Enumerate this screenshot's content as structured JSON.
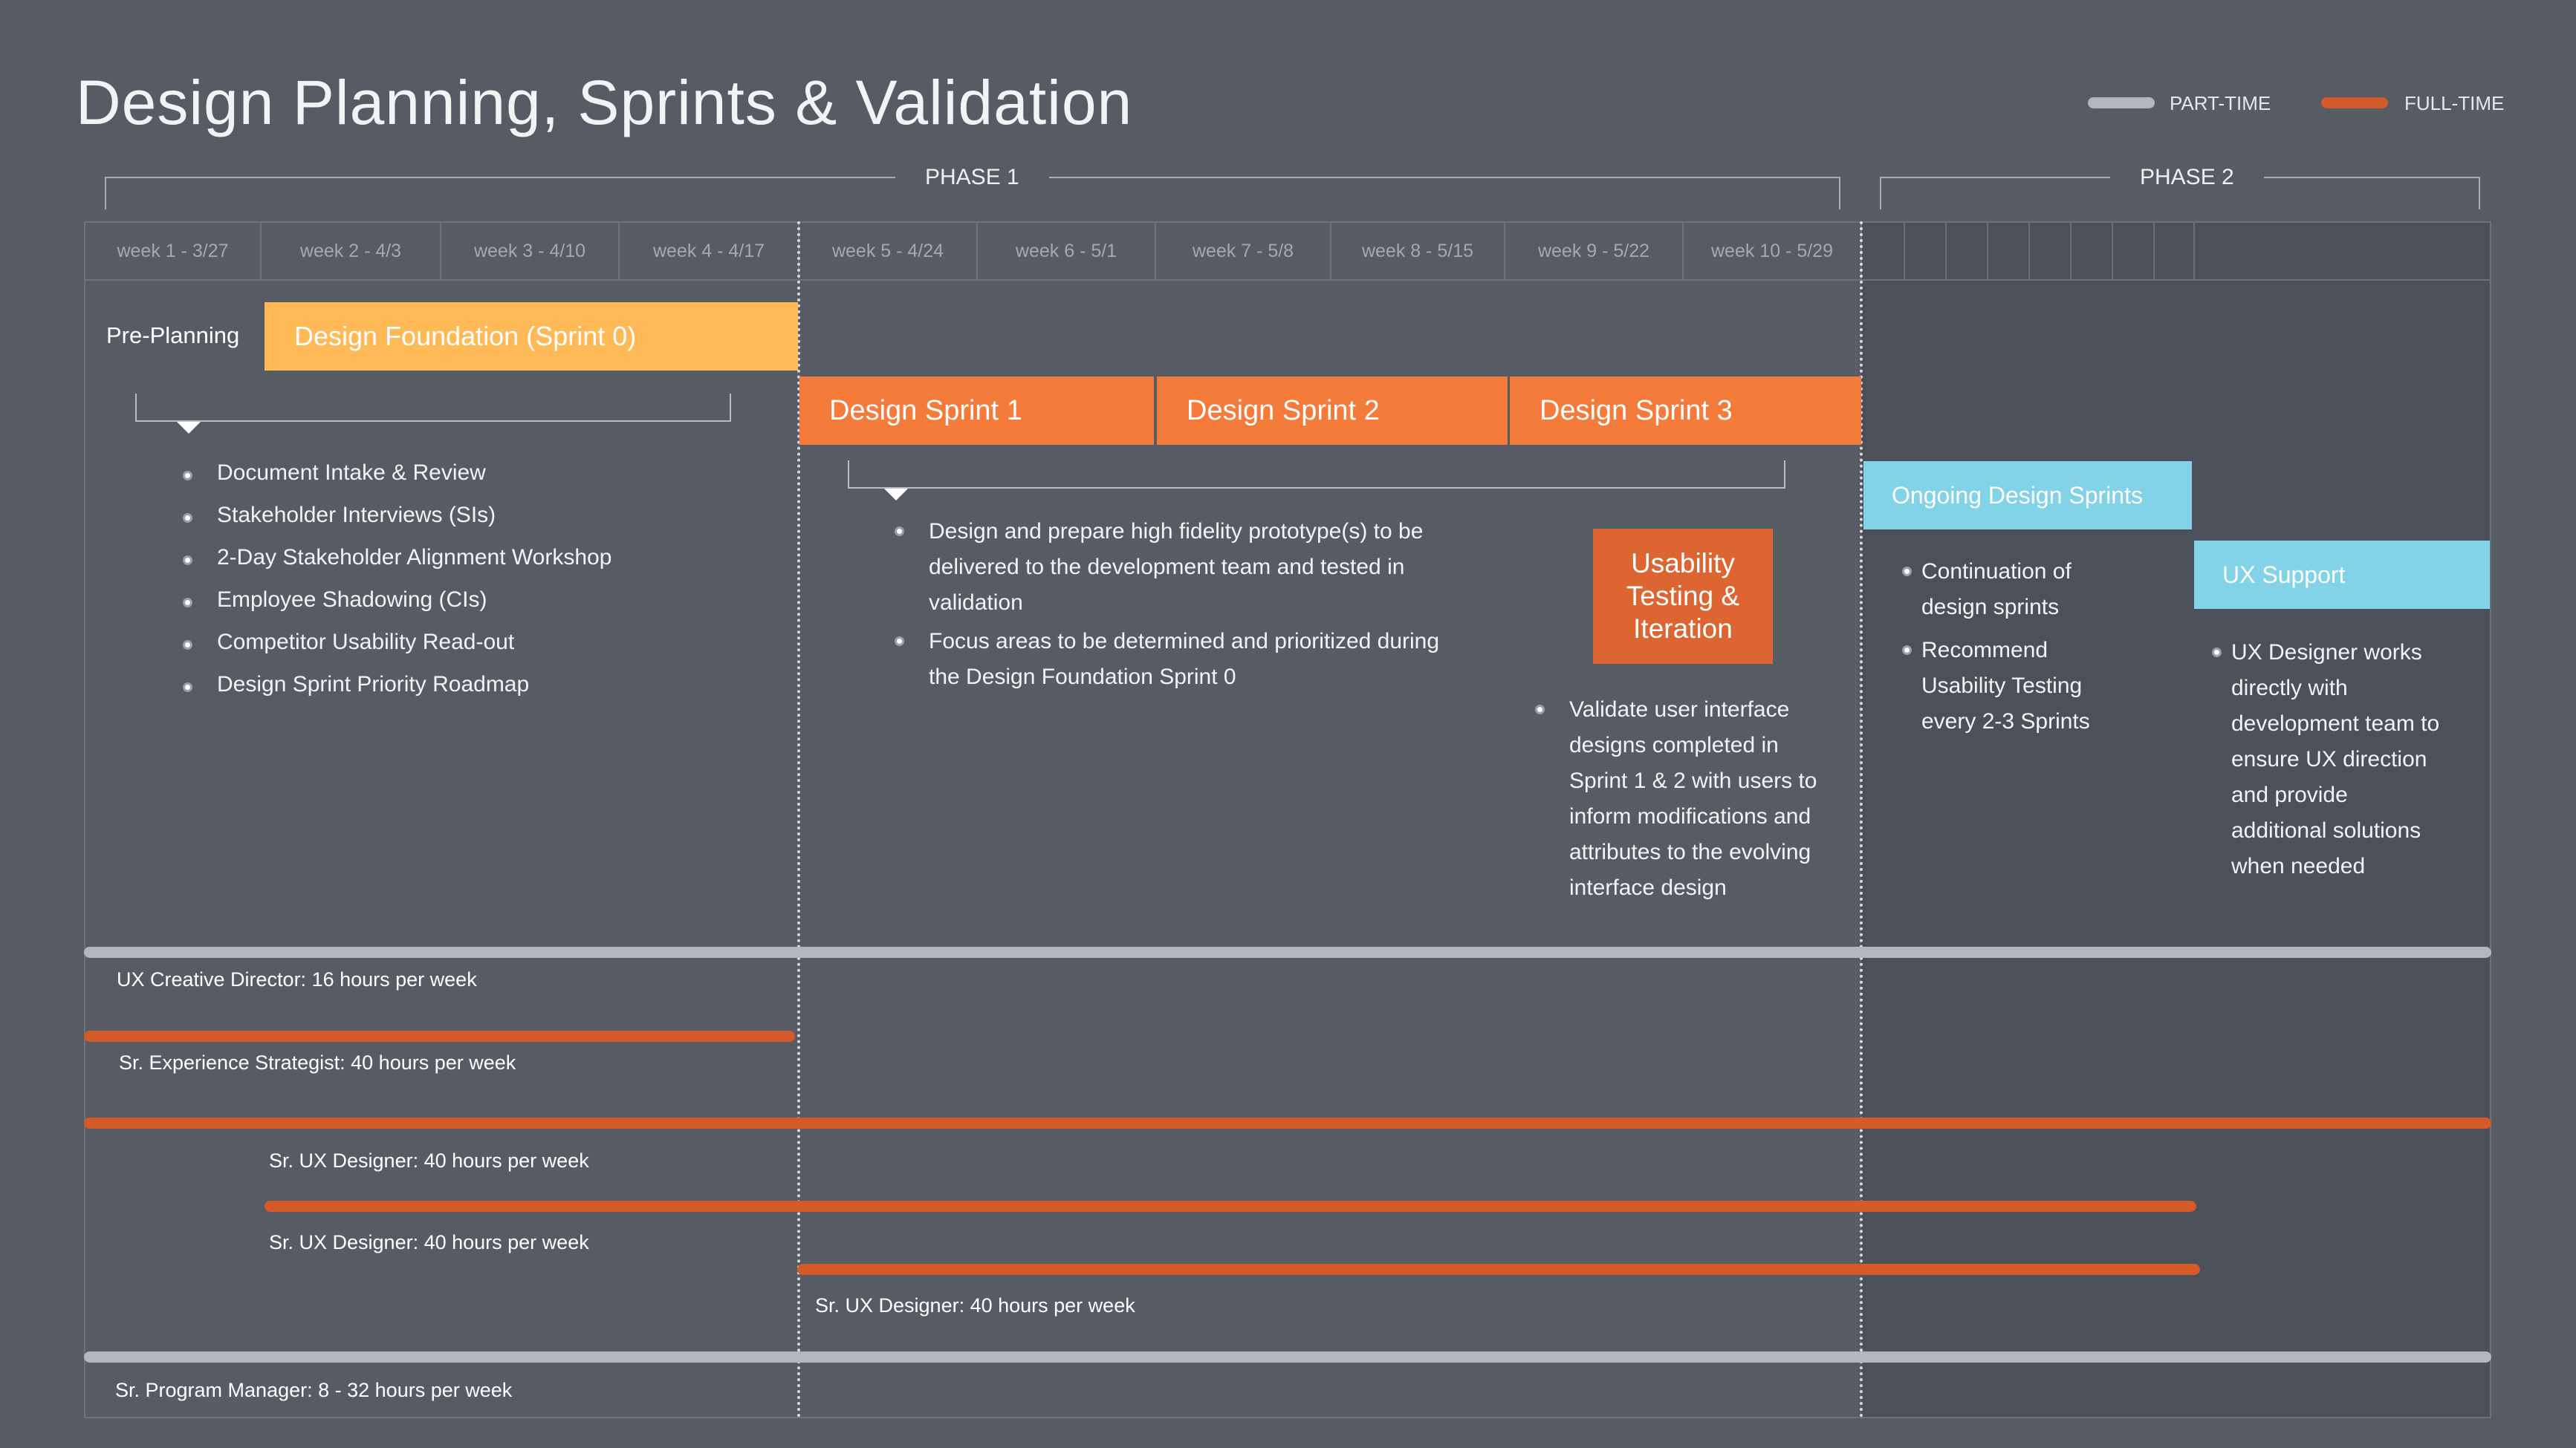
{
  "title": "Design Planning, Sprints & Validation",
  "legend": {
    "part_time": "PART-TIME",
    "full_time": "FULL-TIME",
    "part_time_color": "#b3b7bd",
    "full_time_color": "#d45a2a"
  },
  "phases": [
    "PHASE 1",
    "PHASE 2"
  ],
  "weeks": [
    "week 1 - 3/27",
    "week 2 - 4/3",
    "week 3 - 4/10",
    "week 4 - 4/17",
    "week 5 - 4/24",
    "week 6 - 5/1",
    "week 7 - 5/8",
    "week 8 - 5/15",
    "week 9 - 5/22",
    "week 10 - 5/29"
  ],
  "pre_planning": "Pre-Planning",
  "foundation": {
    "label": "Design Foundation (Sprint 0)",
    "items": [
      "Document Intake & Review",
      "Stakeholder Interviews (SIs)",
      "2-Day Stakeholder Alignment Workshop",
      "Employee Shadowing (CIs)",
      "Competitor Usability Read-out",
      "Design Sprint Priority Roadmap"
    ]
  },
  "sprints": [
    "Design Sprint 1",
    "Design Sprint 2",
    "Design Sprint 3"
  ],
  "sprint_notes": [
    [
      "Design and prepare high fidelity prototype(s) to be",
      "delivered to the development team and tested in",
      "validation"
    ],
    [
      "Focus areas to be determined and prioritized during",
      "the Design Foundation Sprint 0"
    ]
  ],
  "usability": {
    "label_lines": [
      "Usability",
      "Testing &",
      "Iteration"
    ],
    "note_lines": [
      "Validate user interface",
      "designs completed in",
      "Sprint 1 & 2 with users to",
      "inform modifications and",
      "attributes to the evolving",
      "interface design"
    ]
  },
  "ongoing": {
    "label": "Ongoing Design Sprints",
    "notes": [
      [
        "Continuation of",
        "design sprints"
      ],
      [
        "Recommend",
        "Usability Testing",
        "every 2-3 Sprints"
      ]
    ]
  },
  "ux_support": {
    "label": "UX Support",
    "note_lines": [
      "UX Designer works",
      "directly with",
      "development  team to",
      "ensure UX direction",
      "and provide",
      "additional solutions",
      "when needed"
    ]
  },
  "resources": [
    "UX Creative Director: 16 hours per week",
    "Sr. Experience Strategist: 40 hours per week",
    "Sr. UX Designer: 40 hours per week",
    "Sr. UX Designer: 40 hours per week",
    "Sr. UX Designer: 40 hours per week",
    "Sr. Program Manager: 8 - 32 hours per week"
  ]
}
